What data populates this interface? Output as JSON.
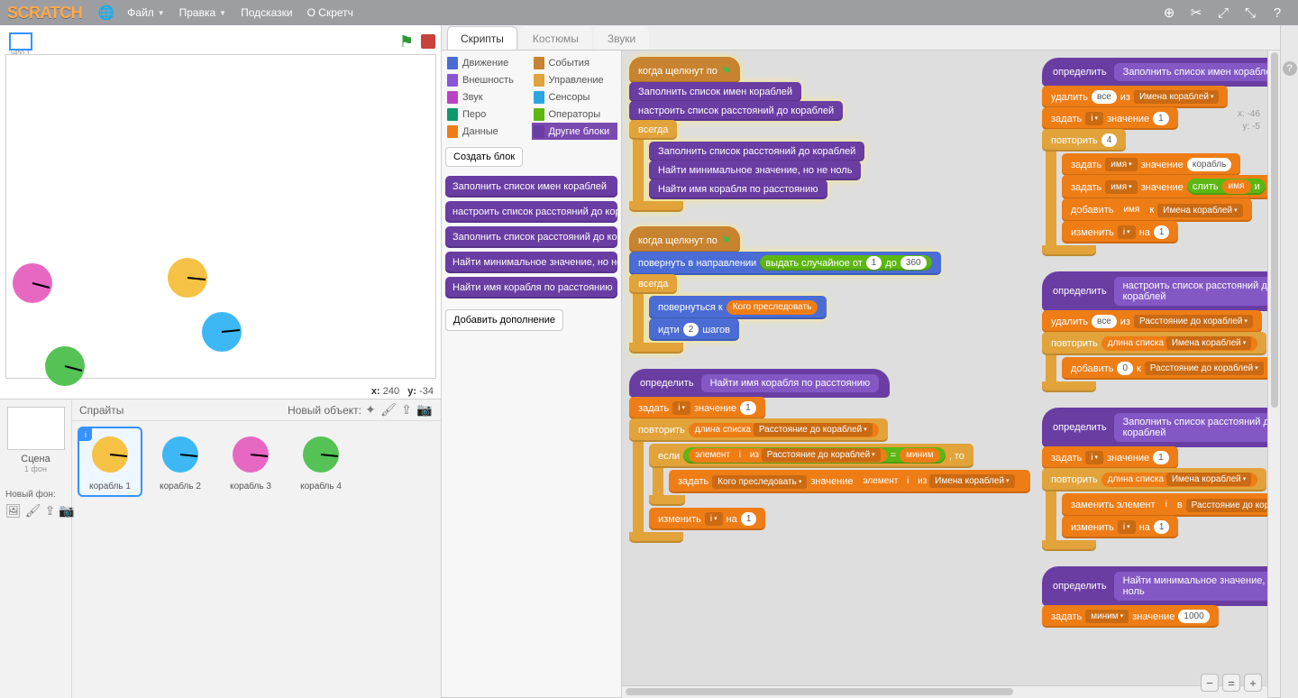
{
  "menu": {
    "logo": "SCRATCH",
    "file": "Файл",
    "edit": "Правка",
    "tips": "Подсказки",
    "about": "О Скретч"
  },
  "stage": {
    "version": "v450.1",
    "coords_label_x": "x:",
    "coords_val_x": "240",
    "coords_label_y": "y:",
    "coords_val_y": "-34"
  },
  "sprites": {
    "title": "Спрайты",
    "newobj": "Новый объект:",
    "scene": "Сцена",
    "scene_sub": "1 фон",
    "newbk": "Новый фон:",
    "list": [
      {
        "name": "корабль 1",
        "color": "#f6c245",
        "sel": true
      },
      {
        "name": "корабль 2",
        "color": "#3db8f5"
      },
      {
        "name": "корабль 3",
        "color": "#e768c2"
      },
      {
        "name": "корабль 4",
        "color": "#55c255"
      }
    ]
  },
  "tabs": {
    "scripts": "Скрипты",
    "costumes": "Костюмы",
    "sounds": "Звуки"
  },
  "categories": [
    {
      "name": "Движение",
      "color": "#4a6cd4"
    },
    {
      "name": "События",
      "color": "#c88330"
    },
    {
      "name": "Внешность",
      "color": "#8a55d7"
    },
    {
      "name": "Управление",
      "color": "#e1a33a"
    },
    {
      "name": "Звук",
      "color": "#bb42c3"
    },
    {
      "name": "Сенсоры",
      "color": "#2ca5e2"
    },
    {
      "name": "Перо",
      "color": "#0e9a6c"
    },
    {
      "name": "Операторы",
      "color": "#5cb712"
    },
    {
      "name": "Данные",
      "color": "#ee7d16"
    },
    {
      "name": "Другие блоки",
      "color": "#6a3da3",
      "active": true
    }
  ],
  "palette": {
    "makeblock": "Создать блок",
    "blocks": [
      "Заполнить список имен кораблей",
      "настроить список расстояний до кораблей",
      "Заполнить список расстояний до кораблей",
      "Найти минимальное значение, но не ноль",
      "Найти имя корабля по расстоянию"
    ],
    "addext": "Добавить дополнение"
  },
  "ws": {
    "xlabel": "x:",
    "xval": "-46",
    "ylabel": "y:",
    "yval": "-5"
  },
  "blocks": {
    "when_flag": "когда щелкнут по",
    "fill_names": "Заполнить список имен кораблей",
    "setup_dist": "настроить список расстояний до кораблей",
    "forever": "всегда",
    "fill_dist": "Заполнить список расстояний до кораблей",
    "find_min": "Найти минимальное значение, но не ноль",
    "find_name": "Найти имя корабля по расстоянию",
    "point_dir": "повернуть в направлении",
    "rand": "выдать случайное от",
    "rand_to": "до",
    "rand_a": "1",
    "rand_b": "360",
    "point_to": "повернуться к",
    "target": "Кого преследовать",
    "move": "идти",
    "move_n": "2",
    "move_steps": "шагов",
    "define": "определить",
    "def_findname": "Найти имя корабля по расстоянию",
    "set": "задать",
    "value": "значение",
    "one": "1",
    "repeat": "повторить",
    "len": "длина списка",
    "dist_list": "Расстояние до кораблей",
    "if": "если",
    "elem": "элемент",
    "of": "из",
    "eq": "=",
    "min": "миним",
    "then": ", то",
    "set_target": "Кого преследовать",
    "elem2": "элемент",
    "names_list": "Имена кораблей",
    "change": "изменить",
    "by": "на",
    "def_fillnames": "Заполнить список имен кораблей",
    "delete": "удалить",
    "all": "все",
    "from": "из",
    "four": "4",
    "name_var": "имя",
    "ship_str": "корабль",
    "join": "слить",
    "and": "и",
    "add": "добавить",
    "to": "к",
    "def_setupdist": "настроить список расстояний до кораблей",
    "zero": "0",
    "def_filldist": "Заполнить список расстояний до кораблей",
    "replace": "заменить элемент",
    "in": "в",
    "in_list": "Расстояние до кораблей",
    "def_findmin": "Найти минимальное значение, но не ноль",
    "min_var": "миним",
    "thousand": "1000",
    "i": "i"
  }
}
